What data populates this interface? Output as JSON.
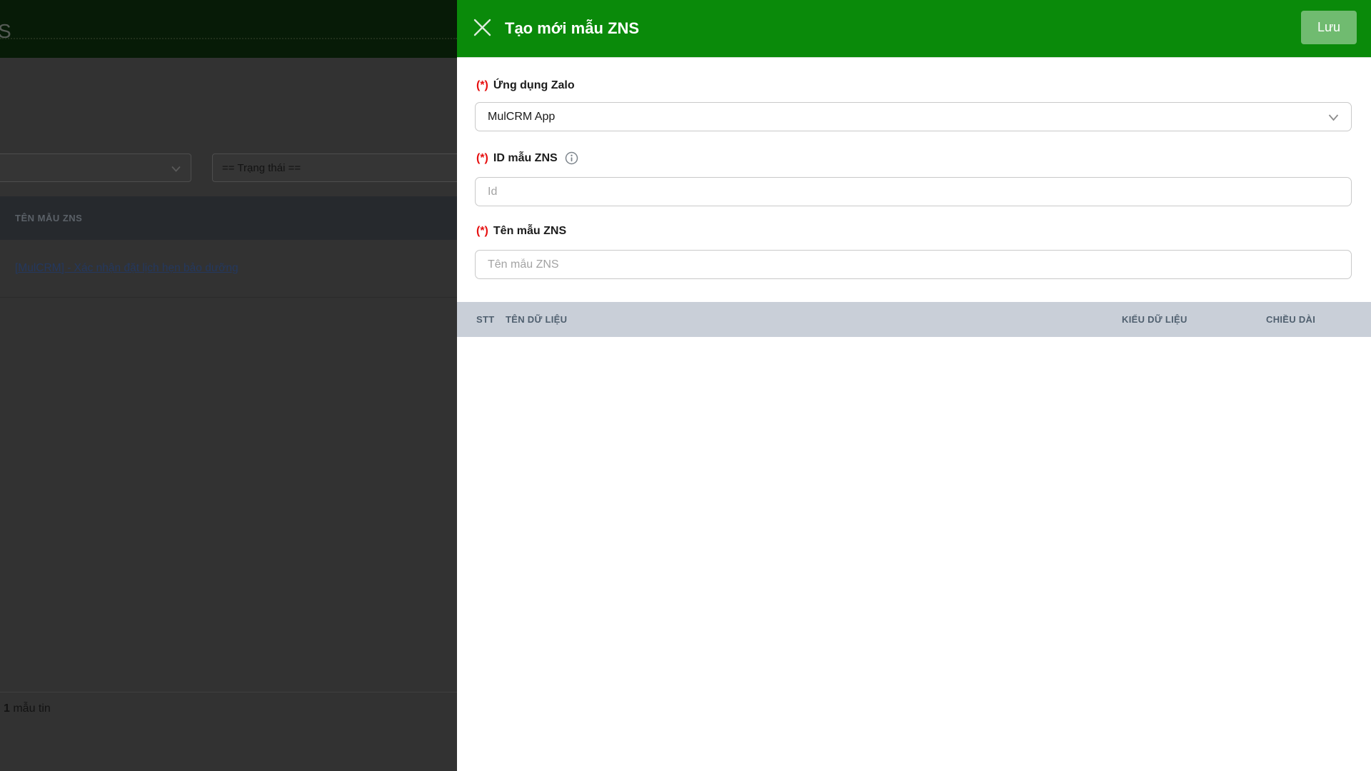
{
  "backdrop_page": {
    "partial_title_letter": "S",
    "filters": {
      "status_select_value": "== Trạng thái =="
    },
    "table": {
      "header_label": "TÊN MẪU ZNS",
      "rows": [
        {
          "name_link": "[MulCRM] - Xác nhận đặt lịch hẹn bảo dưỡng"
        }
      ]
    },
    "footer": {
      "record_count": "1",
      "record_count_suffix": " mẫu tin"
    }
  },
  "panel": {
    "title": "Tạo mới mẫu ZNS",
    "save_label": "Lưu",
    "required_mark": "(*)",
    "fields": {
      "app": {
        "label": "Ứng dụng Zalo",
        "value": "MulCRM App"
      },
      "id": {
        "label": "ID mẫu ZNS",
        "placeholder": "Id"
      },
      "name": {
        "label": "Tên mẫu ZNS",
        "placeholder": "Tên mẫu ZNS"
      }
    },
    "params_table": {
      "columns": [
        "STT",
        "TÊN DỮ LIỆU",
        "KIỂU DỮ LIỆU",
        "CHIỀU DÀI"
      ]
    }
  },
  "icons": {
    "close": "✕",
    "chevron_down": "⌄",
    "info": "ⓘ"
  },
  "colors": {
    "accent_green": "#0a8a0a",
    "save_button_bg": "rgba(255,255,255,0.42)",
    "required_red": "#e60f0f",
    "table_header_bg": "#c9cfd8",
    "table_header_text": "#50606f",
    "backdrop_dim": "#323232",
    "link_dimmed": "#24385e"
  }
}
